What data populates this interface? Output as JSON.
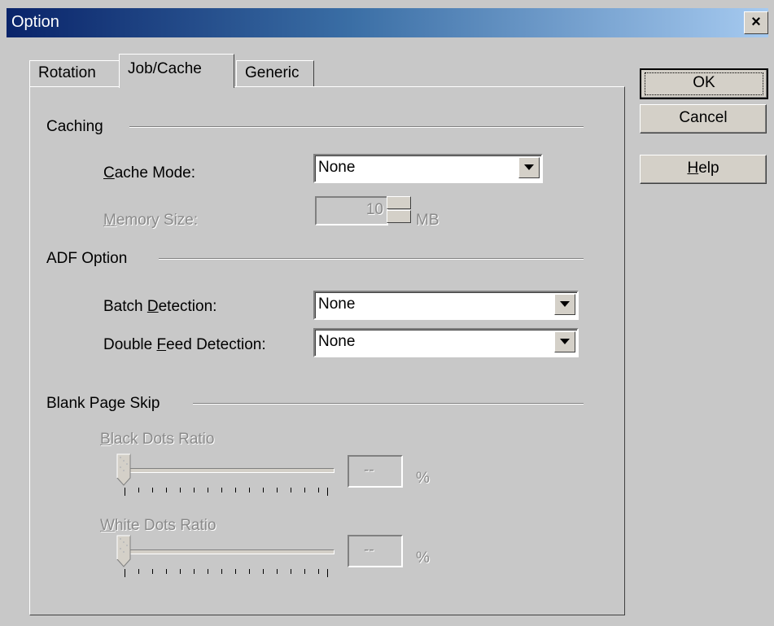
{
  "window": {
    "title": "Option",
    "close": "×"
  },
  "tabs": [
    {
      "label": "Rotation"
    },
    {
      "label": "Job/Cache"
    },
    {
      "label": "Generic"
    }
  ],
  "buttons": {
    "ok": "OK",
    "cancel": "Cancel",
    "help": "Help"
  },
  "caching": {
    "group": "Caching",
    "cache_mode_label": "Cache Mode:",
    "cache_mode_value": "None",
    "memory_size_label": "Memory Size:",
    "memory_size_value": "10",
    "memory_unit": "MB"
  },
  "adf": {
    "group": "ADF Option",
    "batch_label": "Batch Detection:",
    "batch_value": "None",
    "double_label": "Double Feed Detection:",
    "double_value": "None"
  },
  "blank": {
    "group": "Blank Page Skip",
    "black_label": "Black Dots Ratio",
    "black_value": "--",
    "white_label": "White Dots Ratio",
    "white_value": "--",
    "unit": "%"
  }
}
